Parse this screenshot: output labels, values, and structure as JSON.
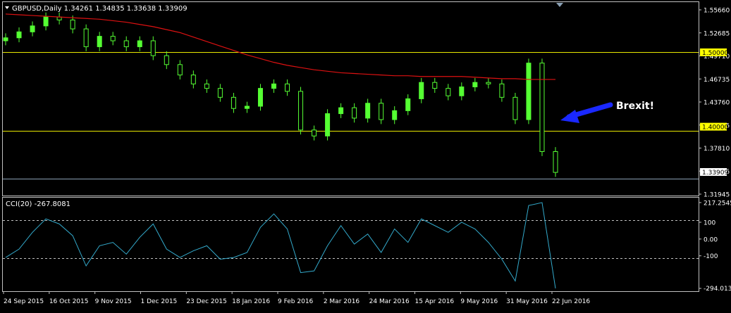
{
  "window": {
    "symbol_header": "GBPUSD,Daily  1.34261 1.34835 1.33638 1.33909",
    "menu_icon": "triangle-down-icon",
    "scroll_marker_icon": "triangle-down-icon"
  },
  "colors": {
    "background": "#000000",
    "frame": "#c0c0c0",
    "text": "#ffffff",
    "candle": "#55ff33",
    "moving_average": "#dd1111",
    "level_line": "#e8e800",
    "current_price_line": "#8aa0b4",
    "cci_line": "#33aacc",
    "cci_level": "#c0c0c0",
    "arrow": "#1a28ff",
    "level_label_bg": "#ffff00",
    "price_label_bg": "#ffffff"
  },
  "annotation": {
    "text": "Brexit!",
    "arrow_icon": "blue-arrow-icon"
  },
  "price_axis": {
    "ticks": [
      "1.55660",
      "1.52685",
      "1.49710",
      "1.46735",
      "1.43760",
      "1.40785",
      "1.37810",
      "1.34835",
      "1.31945"
    ],
    "labels": [
      {
        "text": "1.50000",
        "kind": "level"
      },
      {
        "text": "1.40000",
        "kind": "level"
      },
      {
        "text": "1.33909",
        "kind": "current"
      }
    ]
  },
  "cci": {
    "header": "CCI(20) -267.8081",
    "ticks": [
      "217.2545",
      "100",
      "0.00",
      "-100",
      "-294.0134"
    ],
    "levels": [
      100,
      -100
    ]
  },
  "time_axis": {
    "labels": [
      "24 Sep 2015",
      "16 Oct 2015",
      "9 Nov 2015",
      "1 Dec 2015",
      "23 Dec 2015",
      "18 Jan 2016",
      "9 Feb 2016",
      "2 Mar 2016",
      "24 Mar 2016",
      "15 Apr 2016",
      "9 May 2016",
      "31 May 2016",
      "22 Jun 2016"
    ]
  },
  "chart_data": [
    {
      "type": "candlestick",
      "title": "GBPUSD,Daily  1.34261 1.34835 1.33638 1.33909",
      "ylim": [
        1.3145,
        1.5595
      ],
      "grid": false,
      "x": [
        "2015-09-24",
        "2015-10-01",
        "2015-10-08",
        "2015-10-15",
        "2015-10-22",
        "2015-10-29",
        "2015-11-05",
        "2015-11-12",
        "2015-11-19",
        "2015-11-26",
        "2015-12-03",
        "2015-12-10",
        "2015-12-17",
        "2015-12-24",
        "2015-12-31",
        "2016-01-07",
        "2016-01-14",
        "2016-01-21",
        "2016-01-28",
        "2016-02-04",
        "2016-02-11",
        "2016-02-18",
        "2016-02-25",
        "2016-03-03",
        "2016-03-10",
        "2016-03-17",
        "2016-03-24",
        "2016-03-31",
        "2016-04-07",
        "2016-04-14",
        "2016-04-21",
        "2016-04-28",
        "2016-05-05",
        "2016-05-12",
        "2016-05-19",
        "2016-05-26",
        "2016-06-02",
        "2016-06-09",
        "2016-06-16",
        "2016-06-22",
        "2016-06-24",
        "2016-06-27"
      ],
      "series": [
        {
          "name": "GBPUSD",
          "close": [
            1.52,
            1.528,
            1.536,
            1.548,
            1.544,
            1.532,
            1.508,
            1.522,
            1.516,
            1.508,
            1.516,
            1.496,
            1.484,
            1.47,
            1.458,
            1.452,
            1.44,
            1.425,
            1.428,
            1.452,
            1.458,
            1.448,
            1.396,
            1.388,
            1.418,
            1.426,
            1.412,
            1.432,
            1.41,
            1.422,
            1.438,
            1.46,
            1.452,
            1.442,
            1.454,
            1.46,
            1.458,
            1.44,
            1.41,
            1.486,
            1.367,
            1.339
          ]
        },
        {
          "name": "MA",
          "values": [
            1.552,
            1.551,
            1.55,
            1.549,
            1.548,
            1.547,
            1.546,
            1.545,
            1.543,
            1.541,
            1.538,
            1.535,
            1.531,
            1.527,
            1.521,
            1.515,
            1.509,
            1.503,
            1.497,
            1.492,
            1.487,
            1.483,
            1.48,
            1.477,
            1.475,
            1.473,
            1.472,
            1.471,
            1.47,
            1.469,
            1.469,
            1.468,
            1.468,
            1.468,
            1.468,
            1.467,
            1.466,
            1.465,
            1.465,
            1.464,
            1.464,
            1.464
          ]
        }
      ],
      "levels": [
        1.5,
        1.4,
        1.33909
      ]
    },
    {
      "type": "line",
      "title": "CCI(20) -267.8081",
      "ylim": [
        -294.0134,
        217.2545
      ],
      "x": [
        "2015-09-24",
        "2015-10-01",
        "2015-10-08",
        "2015-10-15",
        "2015-10-22",
        "2015-10-29",
        "2015-11-05",
        "2015-11-12",
        "2015-11-19",
        "2015-11-26",
        "2015-12-03",
        "2015-12-10",
        "2015-12-17",
        "2015-12-24",
        "2015-12-31",
        "2016-01-07",
        "2016-01-14",
        "2016-01-21",
        "2016-01-28",
        "2016-02-04",
        "2016-02-11",
        "2016-02-18",
        "2016-02-25",
        "2016-03-03",
        "2016-03-10",
        "2016-03-17",
        "2016-03-24",
        "2016-03-31",
        "2016-04-07",
        "2016-04-14",
        "2016-04-21",
        "2016-04-28",
        "2016-05-05",
        "2016-05-12",
        "2016-05-19",
        "2016-05-26",
        "2016-06-02",
        "2016-06-09",
        "2016-06-16",
        "2016-06-22",
        "2016-06-24",
        "2016-06-27"
      ],
      "series": [
        {
          "name": "CCI(20)",
          "values": [
            -110,
            -60,
            40,
            120,
            90,
            20,
            -160,
            -40,
            -20,
            -90,
            10,
            90,
            -60,
            -110,
            -70,
            -40,
            -120,
            -110,
            -80,
            70,
            150,
            60,
            -200,
            -190,
            -40,
            80,
            -30,
            30,
            -80,
            60,
            -20,
            120,
            80,
            40,
            100,
            60,
            -20,
            -120,
            -250,
            200,
            217,
            -294
          ]
        }
      ],
      "levels": [
        100,
        0,
        -100
      ]
    }
  ]
}
